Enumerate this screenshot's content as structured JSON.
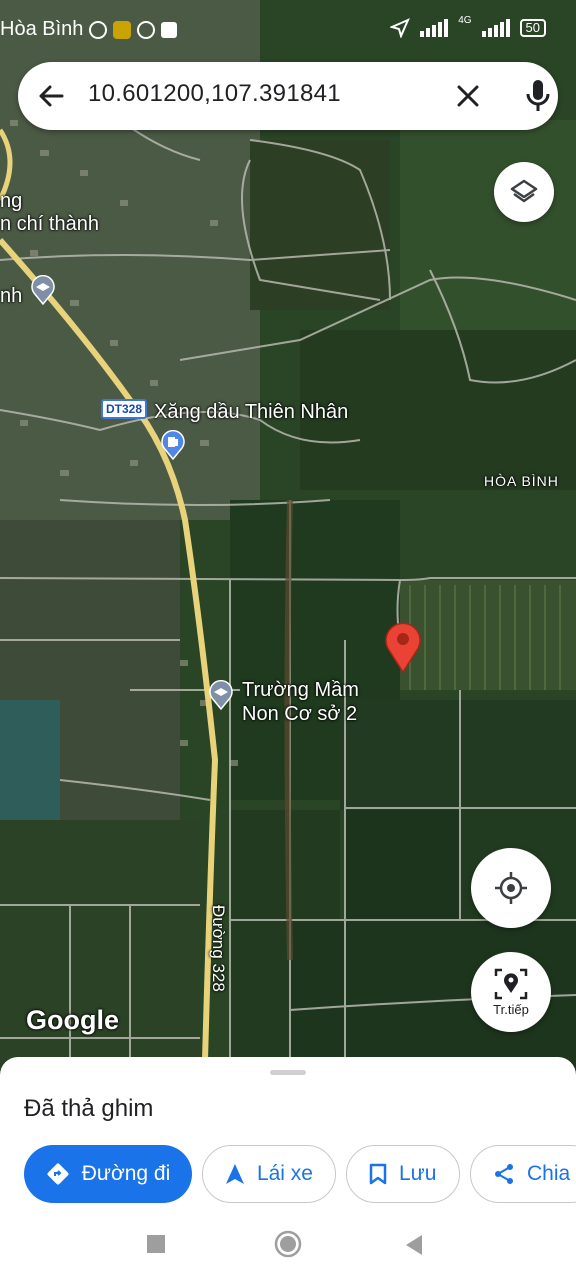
{
  "status_bar": {
    "location_text": "Hòa Bình",
    "network": "4G",
    "battery": "50"
  },
  "search": {
    "query": "10.601200,107.391841"
  },
  "map": {
    "labels": {
      "top_partial_1": "ng",
      "top_partial_2": "n chí thành",
      "school_partial": "nh",
      "gas_station": "Xăng dầu Thiên Nhân",
      "road_shield": "DT328",
      "area": "HÒA BÌNH",
      "kindergarten_line1": "Trường Mầm",
      "kindergarten_line2": "Non Cơ sở 2",
      "road_name": "Đường 328"
    },
    "attribution": "Google"
  },
  "controls": {
    "explore_label": "Tr.tiếp"
  },
  "sheet": {
    "title": "Đã thả ghim",
    "actions": {
      "directions": "Đường đi",
      "drive": "Lái xe",
      "save": "Lưu",
      "share": "Chia"
    }
  },
  "colors": {
    "accent": "#1a73e8",
    "pin": "#ea4335",
    "road": "#e8d27a"
  }
}
